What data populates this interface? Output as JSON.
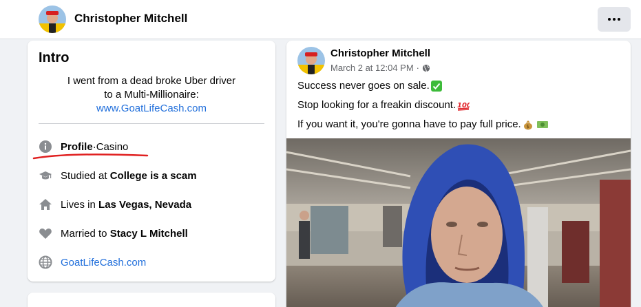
{
  "header": {
    "name": "Christopher Mitchell",
    "more_icon": "more-icon"
  },
  "intro": {
    "title": "Intro",
    "bio_line1": "I went from a dead broke Uber driver",
    "bio_line2": "to a Multi-Millionaire:",
    "bio_link": "www.GoatLifeCash.com",
    "profile": {
      "label": "Profile",
      "separator": " · ",
      "category": "Casino",
      "icon": "info-icon"
    },
    "studied": {
      "prefix": "Studied at ",
      "value": "College is a scam",
      "icon": "graduation-cap-icon"
    },
    "lives": {
      "prefix": "Lives in ",
      "value": "Las Vegas, Nevada",
      "icon": "home-icon"
    },
    "married": {
      "prefix": "Married to ",
      "value": "Stacy L Mitchell",
      "icon": "heart-icon"
    },
    "website": {
      "value": "GoatLifeCash.com",
      "icon": "globe-icon"
    }
  },
  "post": {
    "author": "Christopher Mitchell",
    "timestamp": "March 2 at 12:04 PM",
    "separator": "·",
    "audience_icon": "globe-icon",
    "line1": "Success never goes on sale.",
    "line2": "Stop looking for a freakin discount.",
    "line3": "If you want it, you're gonna have to pay full price.",
    "emoji1": "check-mark-icon",
    "emoji2": "hundred-points-icon",
    "emoji3": "money-bag-icon",
    "emoji4": "dollar-banknote-icon"
  },
  "colors": {
    "link": "#216fdb",
    "secondary_text": "#65676b",
    "annotation": "#e02020"
  }
}
